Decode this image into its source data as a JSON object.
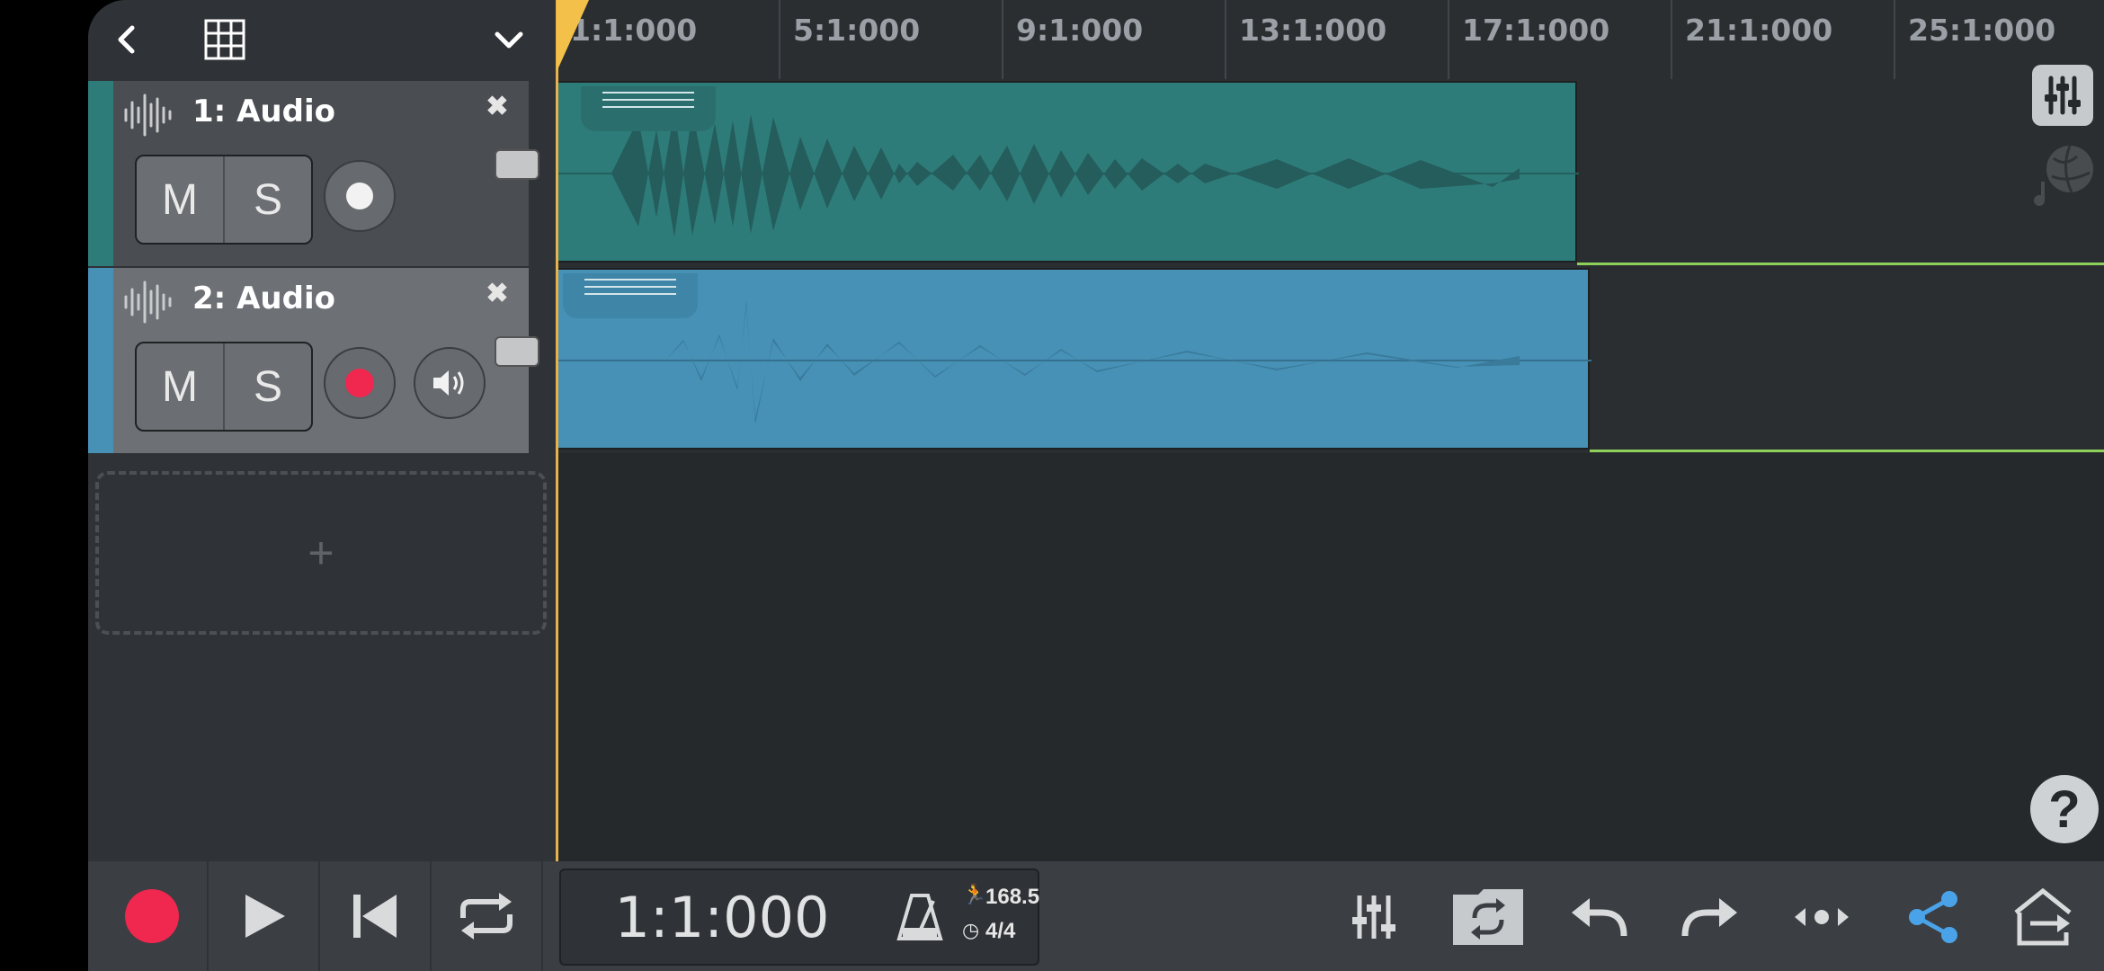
{
  "colors": {
    "track1": "#2e7c7a",
    "track2": "#4691b5",
    "record": "#f0274f",
    "playhead": "#f3c14a",
    "loop_line": "#8ed15a",
    "share": "#4aa3e8"
  },
  "header": {
    "back_icon": "chevron-left-icon",
    "grid_icon": "grid-icon",
    "menu_icon": "chevron-down-icon"
  },
  "ruler": {
    "markers": [
      "1:1:000",
      "5:1:000",
      "9:1:000",
      "13:1:000",
      "17:1:000",
      "21:1:000",
      "25:1:000"
    ]
  },
  "tracks": [
    {
      "name": "1: Audio",
      "mute": "M",
      "solo": "S",
      "armed": false
    },
    {
      "name": "2: Audio",
      "mute": "M",
      "solo": "S",
      "armed": true
    }
  ],
  "add_track_symbol": "+",
  "help_symbol": "?",
  "transport": {
    "time": "1:1:000",
    "tempo": "168.5",
    "time_signature": "4/4"
  }
}
